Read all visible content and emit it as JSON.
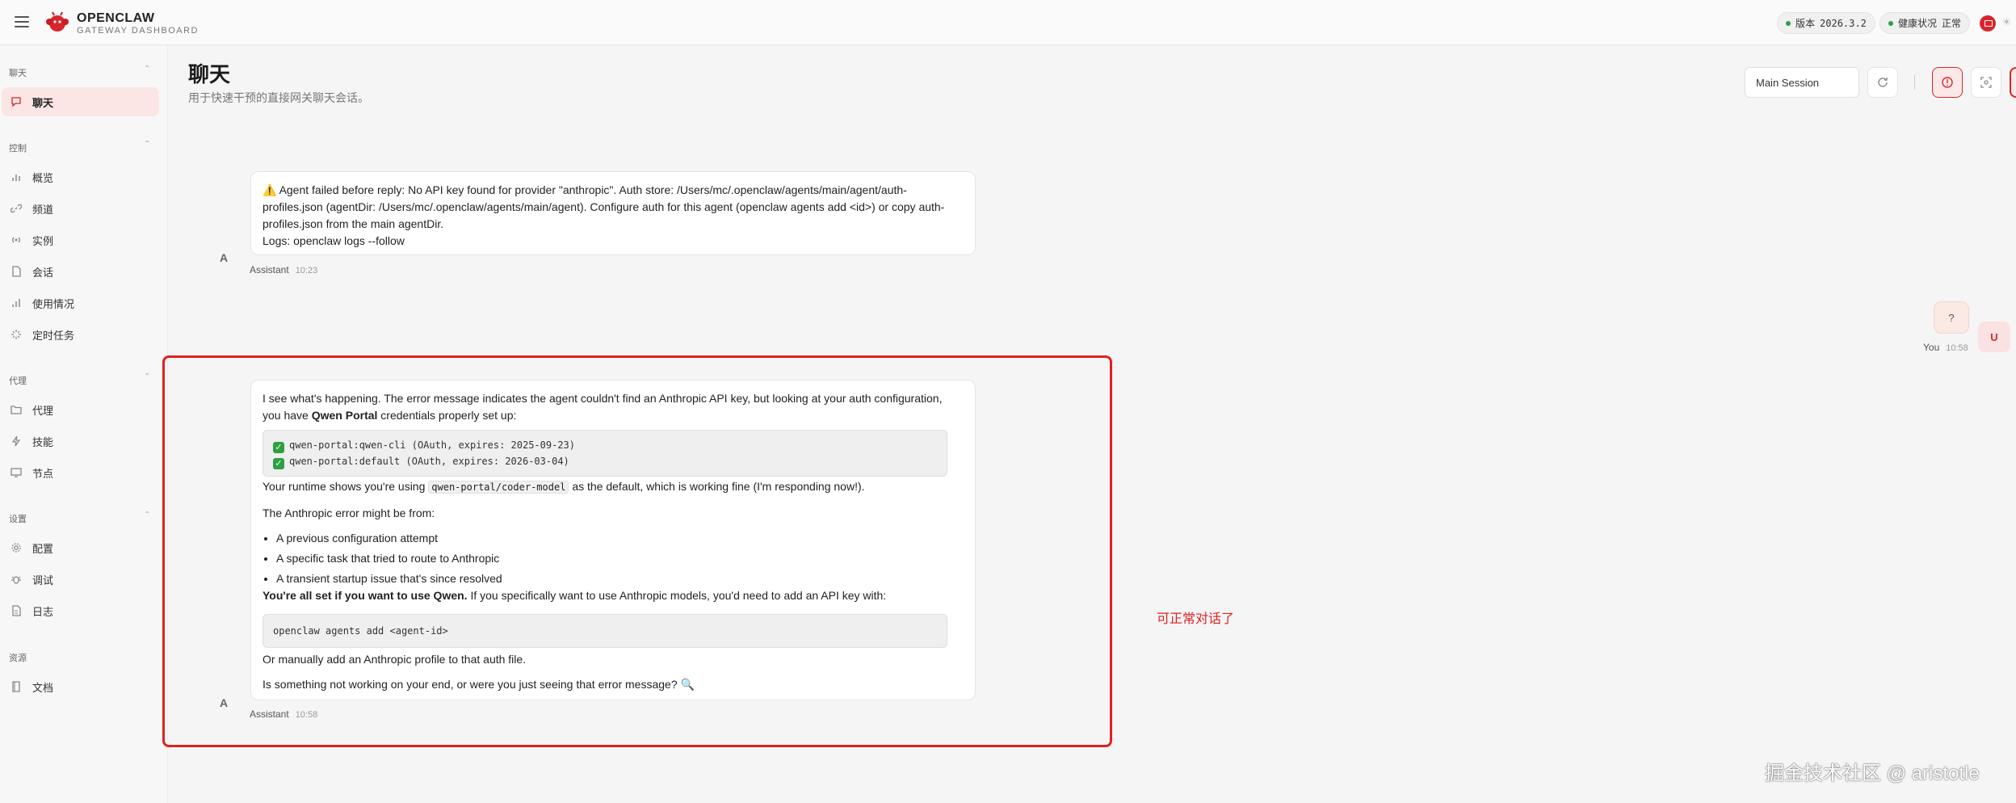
{
  "brand": {
    "title": "OPENCLAW",
    "subtitle": "GATEWAY DASHBOARD"
  },
  "topbar": {
    "version_label": "版本",
    "version_value": "2026.3.2",
    "health_label": "健康状况",
    "health_value": "正常",
    "status_color": "#2e9e44"
  },
  "sidebar": {
    "sections": [
      {
        "title": "聊天",
        "items": [
          {
            "label": "聊天",
            "icon": "chat-icon",
            "active": true
          }
        ]
      },
      {
        "title": "控制",
        "items": [
          {
            "label": "概览",
            "icon": "bar-chart-icon"
          },
          {
            "label": "频道",
            "icon": "link-icon"
          },
          {
            "label": "实例",
            "icon": "broadcast-icon"
          },
          {
            "label": "会话",
            "icon": "document-icon"
          },
          {
            "label": "使用情况",
            "icon": "bar-chart-icon"
          },
          {
            "label": "定时任务",
            "icon": "loader-icon"
          }
        ]
      },
      {
        "title": "代理",
        "items": [
          {
            "label": "代理",
            "icon": "folder-icon"
          },
          {
            "label": "技能",
            "icon": "bolt-icon"
          },
          {
            "label": "节点",
            "icon": "monitor-icon"
          }
        ]
      },
      {
        "title": "设置",
        "items": [
          {
            "label": "配置",
            "icon": "gear-icon"
          },
          {
            "label": "调试",
            "icon": "bug-icon"
          },
          {
            "label": "日志",
            "icon": "file-text-icon"
          }
        ]
      },
      {
        "title": "资源",
        "items": [
          {
            "label": "文档",
            "icon": "book-icon"
          }
        ]
      }
    ]
  },
  "header": {
    "title": "聊天",
    "subtitle": "用于快速干预的直接网关聊天会话。",
    "session": "Main Session"
  },
  "messages": {
    "m1": {
      "avatar": "A",
      "warning_icon": "⚠️",
      "line1": "Agent failed before reply: No API key found for provider \"anthropic\". Auth store: /Users/mc/.openclaw/agents/main/agent/auth-",
      "line2": "profiles.json (agentDir: /Users/mc/.openclaw/agents/main/agent). Configure auth for this agent (openclaw agents add <id>) or copy auth-",
      "line3": "profiles.json from the main agentDir.",
      "line4": "Logs: openclaw logs --follow",
      "sender": "Assistant",
      "time": "10:23"
    },
    "m2": {
      "text": "?",
      "avatar": "U",
      "sender": "You",
      "time": "10:58"
    },
    "m3": {
      "avatar": "A",
      "p1a": "I see what's happening. The error message indicates the agent couldn't find an Anthropic API key, but looking at your auth configuration,",
      "p1b_pre": "you have ",
      "p1b_bold": "Qwen Portal",
      "p1b_post": " credentials properly set up:",
      "code1_line1": "qwen-portal:qwen-cli (OAuth, expires: 2025-09-23)",
      "code1_line2": "qwen-portal:default (OAuth, expires: 2026-03-04)",
      "p2_pre": "Your runtime shows you're using ",
      "p2_code": "qwen-portal/coder-model",
      "p2_post": " as the default, which is working fine (I'm responding now!).",
      "p3": "The Anthropic error might be from:",
      "bullets": [
        "A previous configuration attempt",
        "A specific task that tried to route to Anthropic",
        "A transient startup issue that's since resolved"
      ],
      "p4_bold": "You're all set if you want to use Qwen.",
      "p4_post": " If you specifically want to use Anthropic models, you'd need to add an API key with:",
      "code2": "openclaw agents add <agent-id>",
      "p5": "Or manually add an Anthropic profile to that auth file.",
      "p6": "Is something not working on your end, or were you just seeing that error message? 🔍",
      "sender": "Assistant",
      "time": "10:58"
    }
  },
  "annotation": "可正常对话了",
  "watermark": "掘金技术社区 @ aristotle",
  "colors": {
    "accent": "#d8262c",
    "highlight": "#e02020",
    "active_bg": "#fbe5e5"
  }
}
